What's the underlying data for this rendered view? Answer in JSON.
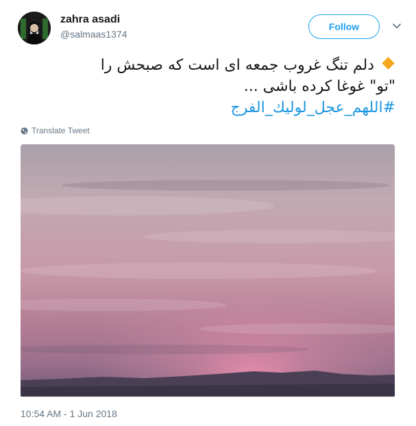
{
  "tweet": {
    "author": {
      "display_name": "zahra asadi",
      "handle": "@salmaas1374"
    },
    "follow_label": "Follow",
    "text_lines": [
      "دلم تنگ غروب جمعه ای است که صبحش را",
      "\"تو\" غوغا کرده باشی ..."
    ],
    "hashtag": "#اللهم_عجل_لوليك_الفرج",
    "translate_label": "Translate Tweet",
    "timestamp": "10:54 AM - 1 Jun 2018",
    "icons": {
      "bullet": "orange-diamond-icon",
      "menu": "chevron-down-icon",
      "translate": "globe-icon"
    },
    "colors": {
      "accent": "#1da1f2",
      "hashtag": "#1b95e0",
      "muted": "#657786",
      "bullet": "#f4a81d"
    },
    "media": {
      "type": "photo",
      "subject": "pink sunset sky over hills"
    }
  }
}
